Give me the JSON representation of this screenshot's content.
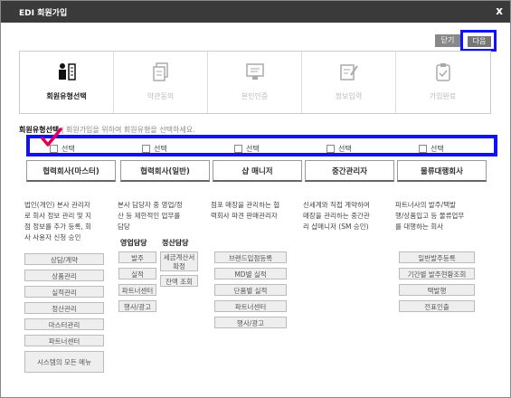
{
  "window": {
    "title": "EDI 회원가입",
    "close_label": "x"
  },
  "top_buttons": {
    "close": "닫기",
    "next": "다음"
  },
  "steps": [
    {
      "label": "회원유형선택",
      "active": true,
      "icon": "person-building-icon"
    },
    {
      "label": "약관동의",
      "active": false,
      "icon": "documents-icon"
    },
    {
      "label": "본인인증",
      "active": false,
      "icon": "monitor-card-icon"
    },
    {
      "label": "정보입력",
      "active": false,
      "icon": "edit-form-icon"
    },
    {
      "label": "가입완료",
      "active": false,
      "icon": "clipboard-check-icon"
    }
  ],
  "section": {
    "title": "회원유형선택",
    "separator": "|",
    "description": "회원가입을 위하여 회원유형을 선택하세요."
  },
  "checkbox_label": "선택",
  "columns": [
    {
      "header": "협력회사(마스터)",
      "description": [
        "법인(개인) 본사 관리자",
        "로 회사 정보 관리 및 지",
        "점 정보를 추가 등록, 회",
        "사 사용자 신청 승인"
      ]
    },
    {
      "header": "협력회사(일반)",
      "description": [
        "본사 담당자 중 영업/정",
        "산 등 제한적인 업무를",
        "담당"
      ]
    },
    {
      "header": "샵 매니저",
      "description": [
        "점포 매장을 관리하는 협",
        "력회사 파견 판매관리자"
      ]
    },
    {
      "header": "중간관리자",
      "description": [
        "신세계와 직접 계약하여",
        "매장을 관리하는 중간관",
        "리 샵매니저 (SM 승인)"
      ]
    },
    {
      "header": "물류대행회사",
      "description": [
        "파트너사의 발주/택발",
        "행/상품입고 등 물류업무",
        "를 대행하는 회사"
      ]
    }
  ],
  "col1_menu": [
    "상담/계약",
    "상품관리",
    "실적관리",
    "정산관리",
    "마스터관리",
    "파트너센터",
    "시스템의 모든 메뉴"
  ],
  "col2_subheads": {
    "sales": "영업담당",
    "settle": "정산담당"
  },
  "col2_sales_menu": [
    "발주",
    "실적",
    "파트너센터",
    "행사/광고"
  ],
  "col2_settle_menu": [
    "세금계산서 확정",
    "잔액 조회"
  ],
  "col3_menu": [
    "브랜드입점등록",
    "MD별 실적",
    "단품별 실적",
    "파트너센터",
    "행사/광고"
  ],
  "col5_menu": [
    "일반발주등록",
    "기간별 발주현황조회",
    "택발행",
    "전표인출"
  ],
  "colors": {
    "highlight": "#1010ff",
    "checkmark": "#e0005a",
    "titlebar": "#3a3a3a"
  }
}
